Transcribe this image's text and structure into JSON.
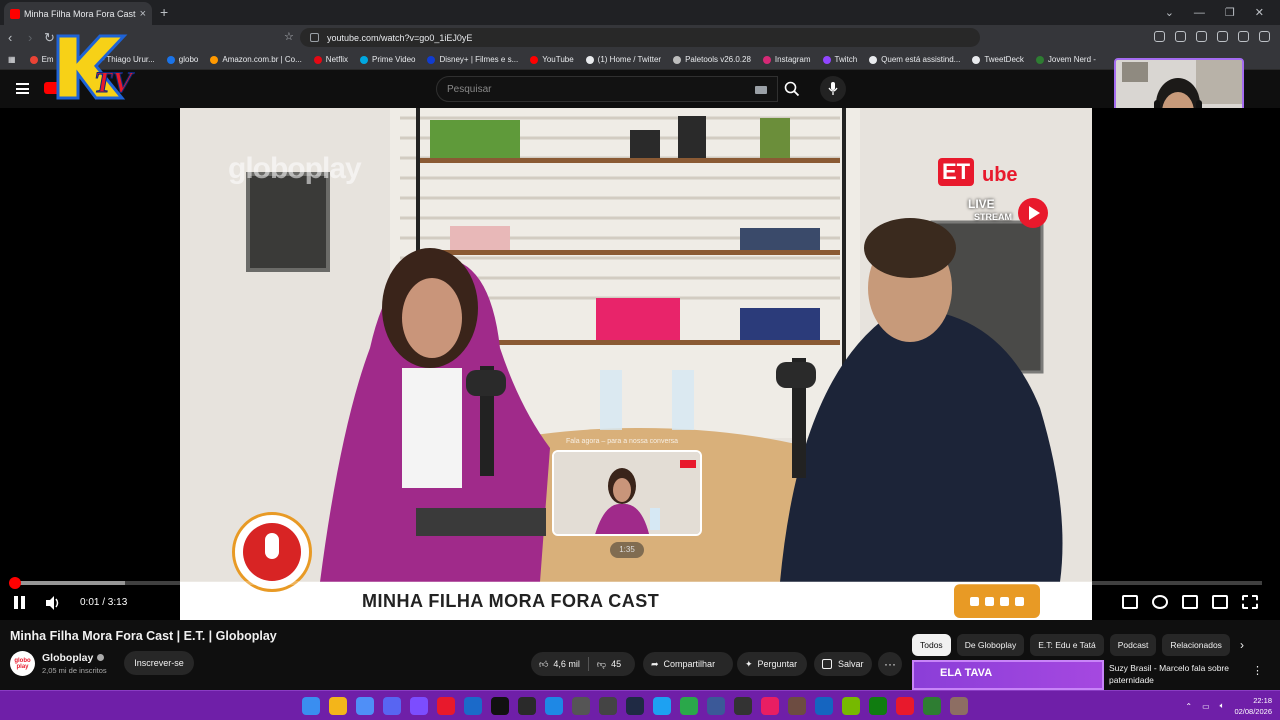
{
  "browser": {
    "tab_title": "Minha Filha Mora Fora Cast | ",
    "tab_close": "×",
    "new_tab": "+",
    "url": "youtube.com/watch?v=go0_1iEJ0yE",
    "bookmarks": [
      {
        "label": "Em",
        "color": "#ea4335"
      },
      {
        "label": "Email – Thiago Urur...",
        "color": "#4285f4"
      },
      {
        "label": "globo",
        "color": "#1a73e8"
      },
      {
        "label": "Amazon.com.br | Co...",
        "color": "#ff9900"
      },
      {
        "label": "Netflix",
        "color": "#e50914"
      },
      {
        "label": "Prime Video",
        "color": "#00a8e1"
      },
      {
        "label": "Disney+ | Filmes e s...",
        "color": "#113ccf"
      },
      {
        "label": "YouTube",
        "color": "#ff0000"
      },
      {
        "label": "(1) Home / Twitter",
        "color": "#e8eaed"
      },
      {
        "label": "Paletools v26.0.28",
        "color": "#bdbdbd"
      },
      {
        "label": "Instagram",
        "color": "#d62976"
      },
      {
        "label": "Twitch",
        "color": "#9146ff"
      },
      {
        "label": "Quem está assistind...",
        "color": "#e8eaed"
      },
      {
        "label": "TweetDeck",
        "color": "#e8eaed"
      },
      {
        "label": "Jovem Nerd -",
        "color": "#2e7d32"
      }
    ]
  },
  "youtube": {
    "search_placeholder": "Pesquisar"
  },
  "video": {
    "watermark": "globoplay",
    "etube_et": "ET",
    "etube_ube": "ube",
    "etube_live": "LIVE",
    "etube_stream": "STREAM",
    "lower_third": "MINHA FILHA MORA FORA CAST",
    "preview_chapter": "Fala agora – para a nossa conversa",
    "preview_time": "1:35",
    "current_time": "0:01 / 3:13",
    "progress_played": 0.002,
    "progress_buffered": 0.09,
    "scrub_position": 0.495
  },
  "info": {
    "title": "Minha Filha Mora Fora Cast | E.T. | Globoplay",
    "channel": "Globoplay",
    "avatar_text": "globo play",
    "subscribers": "2,05 mi de inscritos",
    "subscribe_label": "Inscrever-se",
    "likes": "4,6 mil",
    "dislikes": "45",
    "share_label": "Compartilhar",
    "ask_label": "Perguntar",
    "save_label": "Salvar",
    "more_label": "···"
  },
  "chips": [
    "Todos",
    "De Globoplay",
    "E.T: Edu e Tatá",
    "Podcast",
    "Relacionados"
  ],
  "recommended": {
    "thumb_text": "ELA TAVA",
    "title": "Suzy Brasil - Marcelo fala sobre paternidade"
  },
  "taskbar": {
    "time": "22:18",
    "date": "02/08/2026",
    "icon_colors": [
      "#3a8ef0",
      "#f3b51a",
      "#4f8ff7",
      "#5865f2",
      "#7c4dff",
      "#e8192c",
      "#1b6ac9",
      "#111111",
      "#2a2a2a",
      "#1e88e5",
      "#555555",
      "#444444",
      "#1f2a44",
      "#1da1f2",
      "#2aa84a",
      "#3b5998",
      "#333333",
      "#e91e63",
      "#6d4c41",
      "#1565c0",
      "#76b900",
      "#107c10",
      "#e8192c",
      "#2e7d32",
      "#8d6e63"
    ]
  }
}
